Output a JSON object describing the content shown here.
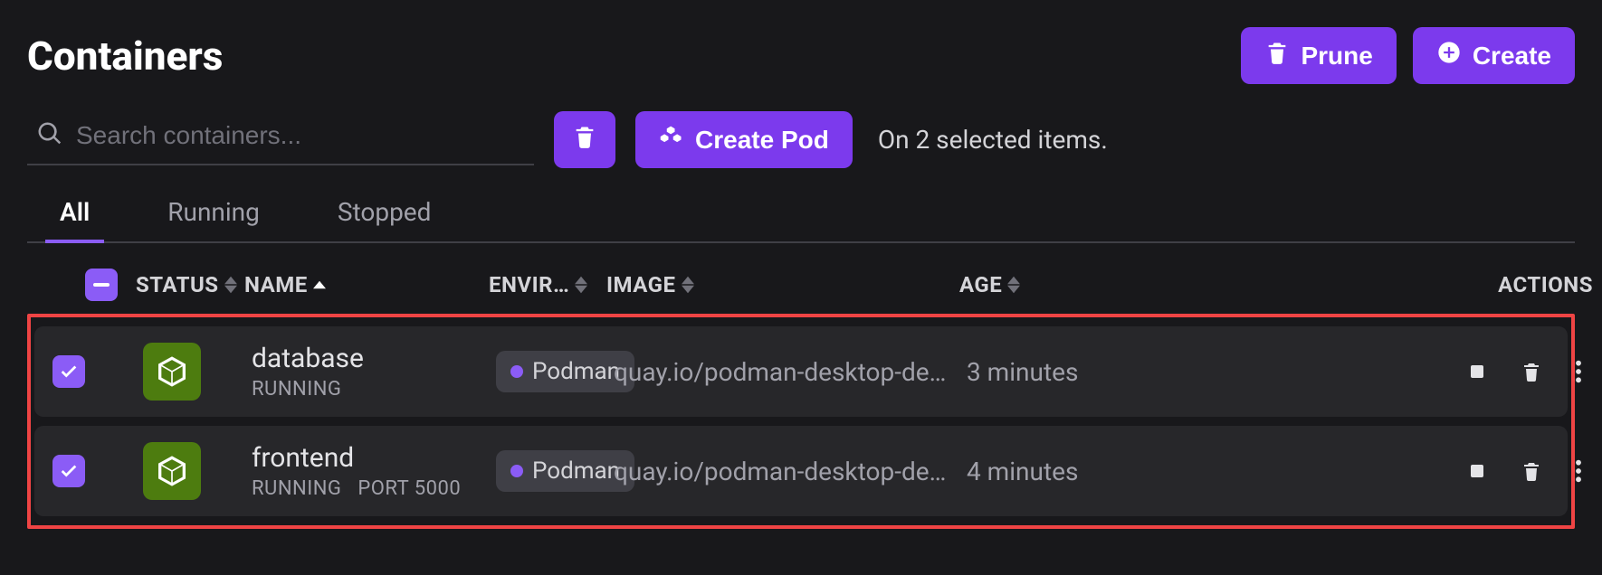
{
  "header": {
    "title": "Containers",
    "prune_label": "Prune",
    "create_label": "Create"
  },
  "toolbar": {
    "search_placeholder": "Search containers...",
    "create_pod_label": "Create Pod",
    "selected_text": "On 2 selected items."
  },
  "tabs": [
    {
      "label": "All",
      "active": true
    },
    {
      "label": "Running",
      "active": false
    },
    {
      "label": "Stopped",
      "active": false
    }
  ],
  "columns": {
    "status": "STATUS",
    "name": "NAME",
    "environment": "ENVIR…",
    "image": "IMAGE",
    "age": "AGE",
    "actions": "ACTIONS"
  },
  "rows": [
    {
      "checked": true,
      "name": "database",
      "status": "RUNNING",
      "port": "",
      "environment": "Podman",
      "image": "quay.io/podman-desktop-dem…",
      "age": "3 minutes"
    },
    {
      "checked": true,
      "name": "frontend",
      "status": "RUNNING",
      "port": "PORT 5000",
      "environment": "Podman",
      "image": "quay.io/podman-desktop-dem…",
      "age": "4 minutes"
    }
  ]
}
